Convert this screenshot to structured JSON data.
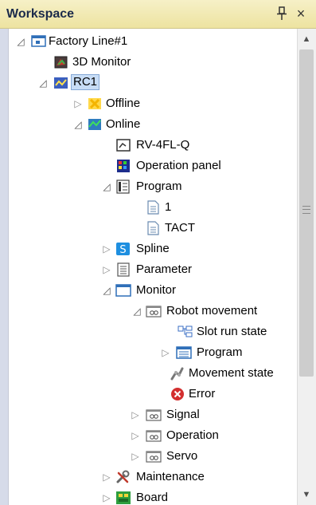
{
  "window": {
    "title": "Workspace",
    "pin_glyph": "ф",
    "close_glyph": "×"
  },
  "tree": {
    "items": [
      {
        "label": "Factory Line#1",
        "icon": "workspace-icon",
        "expanded": true
      },
      {
        "label": "3D Monitor",
        "icon": "3d-monitor-icon"
      },
      {
        "label": "RC1",
        "icon": "robot-controller-icon",
        "expanded": true,
        "selected": true
      },
      {
        "label": "Offline",
        "icon": "offline-icon",
        "expanded": false
      },
      {
        "label": "Online",
        "icon": "online-icon",
        "expanded": true
      },
      {
        "label": "RV-4FL-Q",
        "icon": "robot-model-icon"
      },
      {
        "label": "Operation panel",
        "icon": "operation-panel-icon"
      },
      {
        "label": "Program",
        "icon": "program-folder-icon",
        "expanded": true
      },
      {
        "label": "1",
        "icon": "document-icon"
      },
      {
        "label": "TACT",
        "icon": "document-icon"
      },
      {
        "label": "Spline",
        "icon": "spline-icon",
        "expanded": false
      },
      {
        "label": "Parameter",
        "icon": "parameter-icon",
        "expanded": false
      },
      {
        "label": "Monitor",
        "icon": "monitor-window-icon",
        "expanded": true
      },
      {
        "label": "Robot movement",
        "icon": "monitor-group-icon",
        "expanded": true
      },
      {
        "label": "Slot run state",
        "icon": "slot-run-icon"
      },
      {
        "label": "Program",
        "icon": "program-list-icon",
        "expanded": false
      },
      {
        "label": "Movement state",
        "icon": "movement-state-icon"
      },
      {
        "label": "Error",
        "icon": "error-icon"
      },
      {
        "label": "Signal",
        "icon": "monitor-group-icon",
        "expanded": false
      },
      {
        "label": "Operation",
        "icon": "monitor-group-icon",
        "expanded": false
      },
      {
        "label": "Servo",
        "icon": "monitor-group-icon",
        "expanded": false
      },
      {
        "label": "Maintenance",
        "icon": "maintenance-icon",
        "expanded": false
      },
      {
        "label": "Board",
        "icon": "board-icon",
        "expanded": false
      }
    ]
  },
  "scrollbar": {
    "up_glyph": "▲",
    "down_glyph": "▼"
  }
}
